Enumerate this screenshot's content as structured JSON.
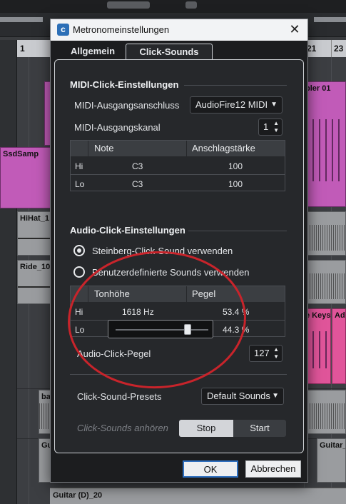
{
  "background": {
    "ruler_numbers": [
      "1",
      "21",
      "23"
    ],
    "track_names": [
      "SsdSamp",
      "HiHat_1",
      "Ride_10",
      "ba",
      "Gui",
      "Guitar_"
    ],
    "event_names": [
      "pler 01",
      "e Keys",
      "Ad"
    ],
    "bottom_track": "Guitar (D)_20"
  },
  "dialog": {
    "title": "Metronomeinstellungen",
    "close_glyph": "✕",
    "tabs": [
      {
        "label": "Allgemein",
        "active": false
      },
      {
        "label": "Click-Sounds",
        "active": true
      }
    ],
    "midi": {
      "section_title": "MIDI-Click-Einstellungen",
      "port_label": "MIDI-Ausgangsanschluss",
      "port_value": "AudioFire12 MIDI",
      "channel_label": "MIDI-Ausgangskanal",
      "channel_value": "1",
      "table": {
        "headers": [
          "Note",
          "Anschlagstärke"
        ],
        "rows": [
          {
            "name": "Hi",
            "note": "C3",
            "velocity": "100"
          },
          {
            "name": "Lo",
            "note": "C3",
            "velocity": "100"
          }
        ]
      }
    },
    "audio": {
      "section_title": "Audio-Click-Einstellungen",
      "option_steinberg": "Steinberg-Click-Sound verwenden",
      "option_custom": "Benutzerdefinierte Sounds verwenden",
      "selected_option": "steinberg",
      "table": {
        "headers": [
          "Tonhöhe",
          "Pegel"
        ],
        "rows": [
          {
            "name": "Hi",
            "pitch": "1618 Hz",
            "level": "53.4 %"
          },
          {
            "name": "Lo",
            "pitch": "",
            "level": "44.3 %"
          }
        ]
      },
      "lo_slider_fraction": 0.78,
      "click_level_label": "Audio-Click-Pegel",
      "click_level_value": "127"
    },
    "presets": {
      "label": "Click-Sound-Presets",
      "value": "Default Sounds"
    },
    "preview": {
      "label": "Click-Sounds anhören",
      "stop_label": "Stop",
      "start_label": "Start"
    },
    "ok_label": "OK",
    "cancel_label": "Abbrechen"
  },
  "colors": {
    "annotation": "#c8242b",
    "accent": "#2f6fbf"
  }
}
